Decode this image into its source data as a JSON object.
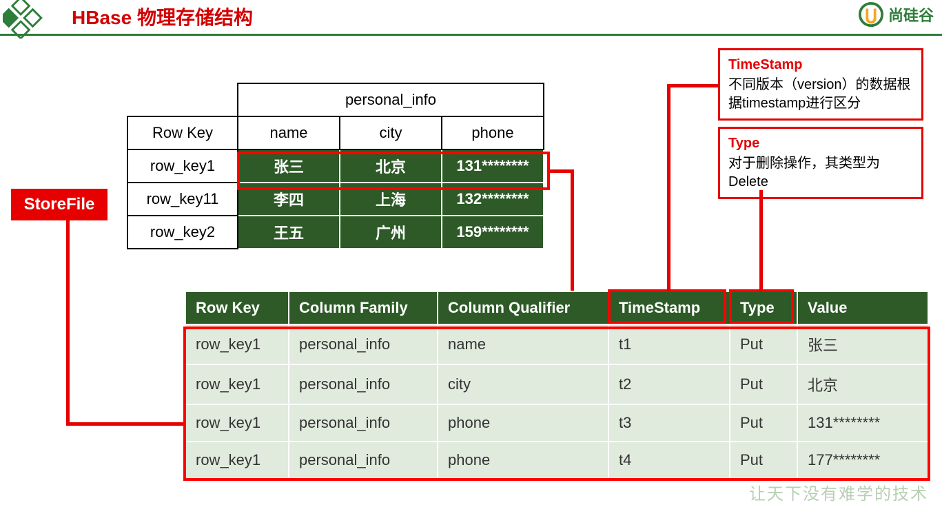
{
  "title": "HBase 物理存储结构",
  "brand_text": "尚硅谷",
  "upper_table": {
    "column_family_header": "personal_info",
    "row_key_header": "Row Key",
    "cols": [
      "name",
      "city",
      "phone"
    ],
    "rows": [
      {
        "rk": "row_key1",
        "cells": [
          "张三",
          "北京",
          "131********"
        ]
      },
      {
        "rk": "row_key11",
        "cells": [
          "李四",
          "上海",
          "132********"
        ]
      },
      {
        "rk": "row_key2",
        "cells": [
          "王五",
          "广州",
          "159********"
        ]
      }
    ]
  },
  "storefile_label": "StoreFile",
  "lower_table": {
    "headers": [
      "Row Key",
      "Column Family",
      "Column Qualifier",
      "TimeStamp",
      "Type",
      "Value"
    ],
    "rows": [
      [
        "row_key1",
        "personal_info",
        "name",
        "t1",
        "Put",
        "张三"
      ],
      [
        "row_key1",
        "personal_info",
        "city",
        "t2",
        "Put",
        "北京"
      ],
      [
        "row_key1",
        "personal_info",
        "phone",
        "t3",
        "Put",
        "131********"
      ],
      [
        "row_key1",
        "personal_info",
        "phone",
        "t4",
        "Put",
        "177********"
      ]
    ]
  },
  "callouts": {
    "timestamp": {
      "title": "TimeStamp",
      "body": "不同版本（version）的数据根据timestamp进行区分"
    },
    "type": {
      "title": "Type",
      "body": "对于删除操作，其类型为Delete"
    }
  },
  "footer": "让天下没有难学的技术"
}
